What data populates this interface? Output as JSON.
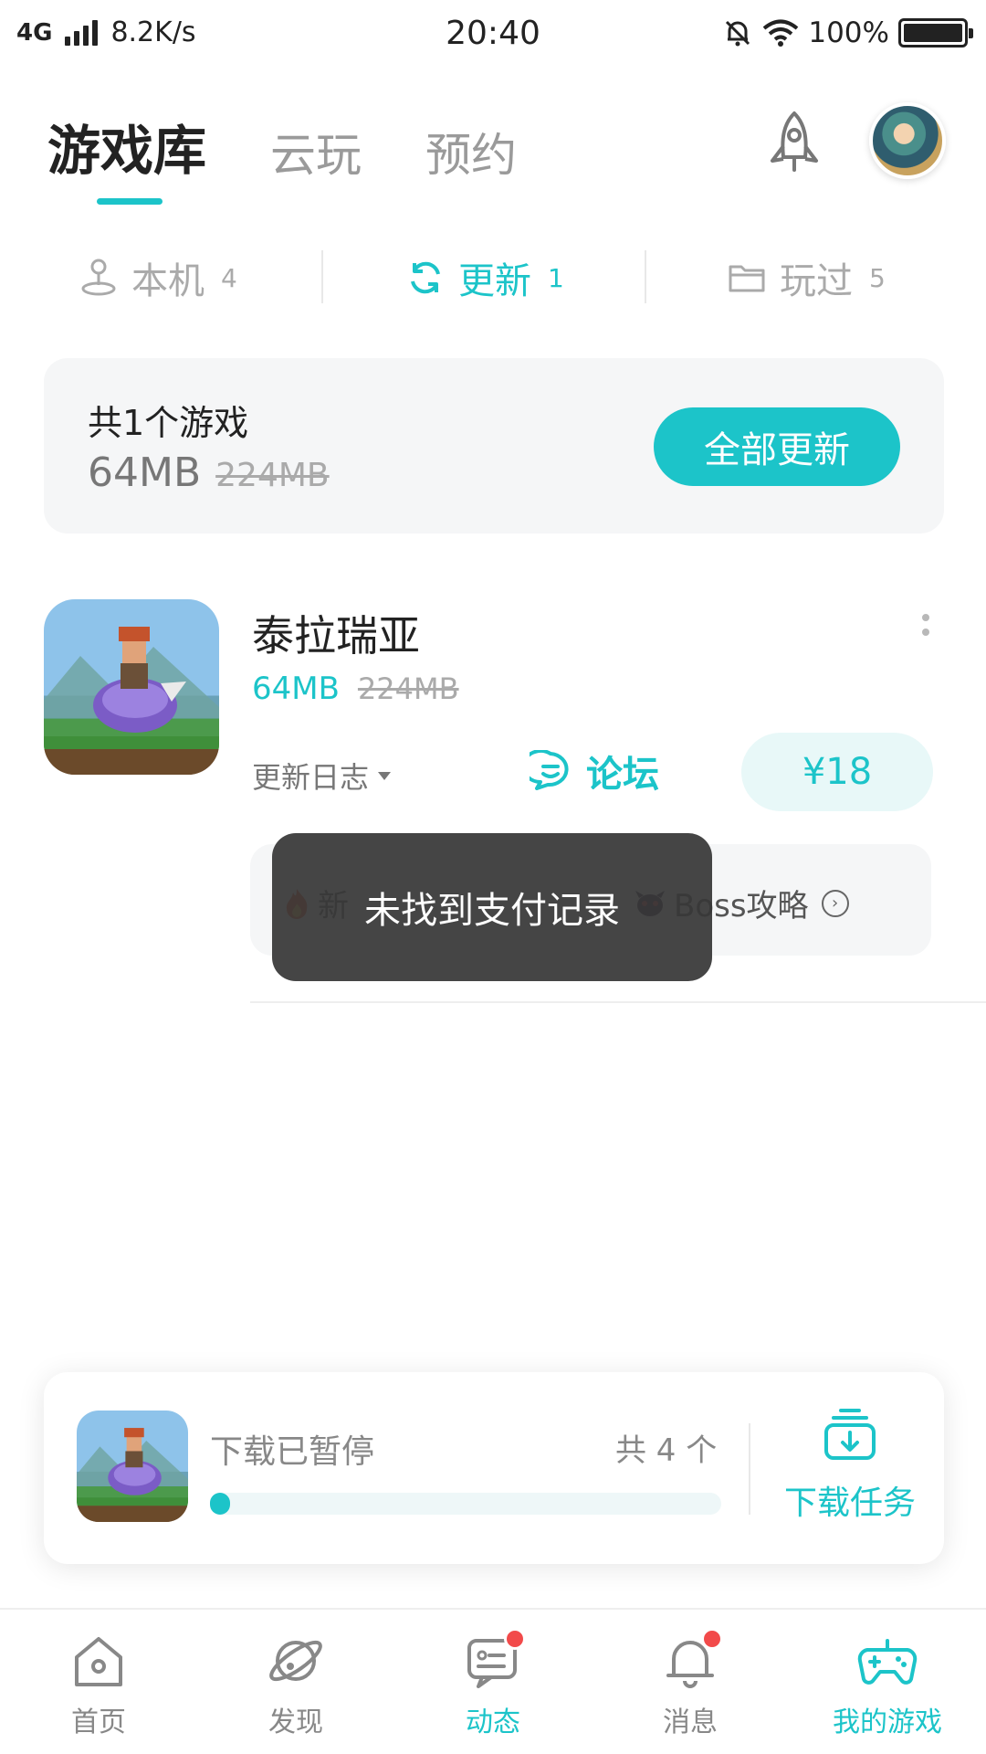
{
  "status_bar": {
    "network": "4G",
    "speed": "8.2K/s",
    "time": "20:40",
    "battery": "100%"
  },
  "top_tabs": [
    {
      "label": "游戏库",
      "active": true
    },
    {
      "label": "云玩",
      "active": false
    },
    {
      "label": "预约",
      "active": false
    }
  ],
  "icons": {
    "rocket": "rocket-icon",
    "avatar": "user-avatar",
    "phone": "joystick-icon",
    "refresh": "refresh-icon",
    "folder": "folder-icon",
    "forum": "chat-icon",
    "download": "download-icon"
  },
  "segments": [
    {
      "label": "本机",
      "count": "4",
      "active": false
    },
    {
      "label": "更新",
      "count": "1",
      "active": true
    },
    {
      "label": "玩过",
      "count": "5",
      "active": false
    }
  ],
  "summary": {
    "count_text": "共1个游戏",
    "size": "64MB",
    "original_size": "224MB",
    "update_all_label": "全部更新"
  },
  "game": {
    "name": "泰拉瑞亚",
    "size": "64MB",
    "original_size": "224MB",
    "changelog_label": "更新日志",
    "forum_label": "论坛",
    "price": "¥18",
    "guide_1": "新",
    "guide_2": "Boss攻略"
  },
  "toast": {
    "message": "未找到支付记录"
  },
  "download": {
    "status": "下载已暂停",
    "count": "共 4 个",
    "progress": 0.03,
    "tasks_label": "下载任务"
  },
  "bottom_nav": [
    {
      "label": "首页",
      "icon": "home-icon",
      "active": false,
      "badge": false
    },
    {
      "label": "发现",
      "icon": "planet-icon",
      "active": false,
      "badge": false
    },
    {
      "label": "动态",
      "icon": "chat-bubble-icon",
      "active": true,
      "badge": true
    },
    {
      "label": "消息",
      "icon": "bell-icon",
      "active": false,
      "badge": true
    },
    {
      "label": "我的游戏",
      "icon": "gamepad-icon",
      "active": false,
      "badge": false
    }
  ],
  "colors": {
    "accent": "#1cc4c9",
    "badge": "#f24a4a",
    "toast_bg": "#373737"
  }
}
